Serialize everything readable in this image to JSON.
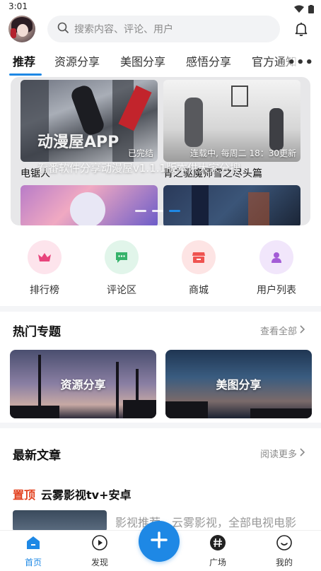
{
  "status": {
    "time": "3:01",
    "icons": [
      "wifi-icon",
      "battery-icon"
    ]
  },
  "header": {
    "search_placeholder": "搜索内容、评论、用户",
    "icons": [
      "search-icon",
      "bell-icon"
    ]
  },
  "tabs": [
    {
      "label": "推荐",
      "active": true
    },
    {
      "label": "资源分享",
      "active": false
    },
    {
      "label": "美图分享",
      "active": false
    },
    {
      "label": "感悟分享",
      "active": false
    },
    {
      "label": "官方通知",
      "active": false
    }
  ],
  "banner": {
    "overlay_title": "动漫屋APP",
    "overlay_subtitle": "看番软件分享动漫屋v1.1.1版本供大家分搜",
    "cards": [
      {
        "title": "电锯人",
        "badge": "已完结"
      },
      {
        "title": "青之驱魔师雪之尽头篇",
        "badge": "连载中, 每周二 18：30更新"
      },
      {
        "title": ""
      },
      {
        "title": ""
      }
    ],
    "active_dot": 2,
    "dot_count": 3
  },
  "quick": [
    {
      "label": "排行榜",
      "icon": "crown-icon",
      "bg": "#fde4ec",
      "color": "#e8447c"
    },
    {
      "label": "评论区",
      "icon": "comment-icon",
      "bg": "#e1f5ea",
      "color": "#36b36b"
    },
    {
      "label": "商城",
      "icon": "shop-icon",
      "bg": "#fde4e4",
      "color": "#ef5350"
    },
    {
      "label": "用户列表",
      "icon": "user-icon",
      "bg": "#f1e6fb",
      "color": "#a35cd6"
    }
  ],
  "hot_topics": {
    "title": "热门专题",
    "more": "查看全部",
    "items": [
      {
        "label": "资源分享"
      },
      {
        "label": "美图分享"
      }
    ]
  },
  "latest": {
    "title": "最新文章",
    "more": "阅读更多",
    "article": {
      "pin": "置顶",
      "title": "云雾影视tv+安卓",
      "snippet": "影视推荐，云雾影视，全部电视电影"
    }
  },
  "bottom_nav": [
    {
      "label": "首页",
      "icon": "home-icon",
      "active": true
    },
    {
      "label": "发现",
      "icon": "discover-icon",
      "active": false
    },
    {
      "label": "广场",
      "icon": "hashtag-icon",
      "active": false
    },
    {
      "label": "我的",
      "icon": "profile-icon",
      "active": false
    }
  ],
  "colors": {
    "accent": "#1e88e5",
    "pin": "#e2411f"
  }
}
